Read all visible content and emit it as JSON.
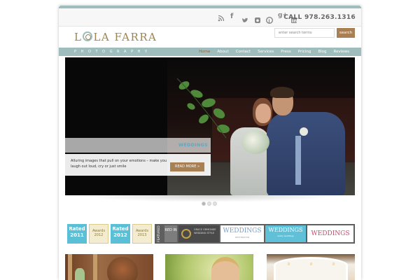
{
  "header": {
    "phone": "CALL 978.263.1316",
    "social_icons": [
      "rss-icon",
      "facebook-icon",
      "twitter-icon",
      "instagram-icon",
      "pinterest-icon",
      "google-plus-icon",
      "linkedin-icon"
    ],
    "logo_text_left": "L",
    "logo_text_right": "LA FARRA",
    "tagline": "PHOTOGRAPHY"
  },
  "search": {
    "placeholder": "enter search terms",
    "button_label": "search"
  },
  "nav": {
    "items": [
      "Home",
      "About",
      "Contact",
      "Services",
      "Press",
      "Pricing",
      "Blog",
      "Reviews"
    ],
    "active": "Home"
  },
  "slider": {
    "category": "WEDDINGS",
    "caption": "Alluring images that pull on your emotions – make you laugh out loud, cry or just smile",
    "read_more": "READ MORE »",
    "dots": 3,
    "active_dot": 0
  },
  "badges": {
    "rated_2011": "Rated 2011",
    "rated_2012": "Rated 2012",
    "award_2012": "Awards 2012",
    "award_2013": "Awards 2013",
    "featured": "FEATURED",
    "red_in": "RED IN",
    "grace": "GRACE ORMONDE WEDDING STYLE",
    "pub1": "WEDDINGS",
    "pub1_sub": "DESTINATION",
    "pub2": "WEDDINGS",
    "pub2_sub": "really weddings",
    "pub3": "WEDDINGS"
  },
  "colors": {
    "accent_teal": "#9fbdbd",
    "accent_brown": "#a97f54",
    "logo_gold": "#9b8354"
  }
}
